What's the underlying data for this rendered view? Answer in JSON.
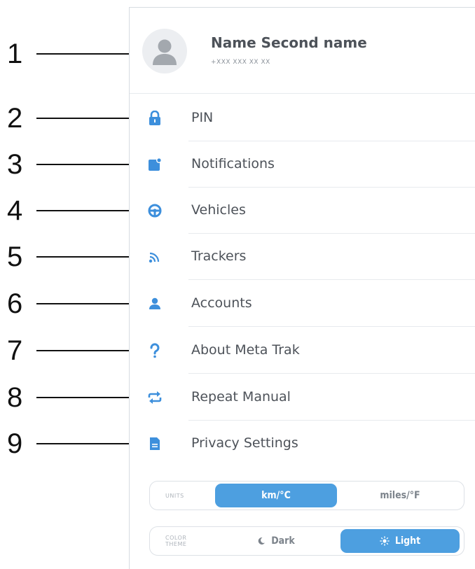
{
  "callouts": [
    "1",
    "2",
    "3",
    "4",
    "5",
    "6",
    "7",
    "8",
    "9"
  ],
  "profile": {
    "name": "Name Second name",
    "phone": "+XXX XXX XX XX"
  },
  "menu": [
    {
      "label": "PIN",
      "icon": "lock-icon"
    },
    {
      "label": "Notifications",
      "icon": "notification-icon"
    },
    {
      "label": "Vehicles",
      "icon": "steering-wheel-icon"
    },
    {
      "label": "Trackers",
      "icon": "signal-icon"
    },
    {
      "label": "Accounts",
      "icon": "user-icon"
    },
    {
      "label": "About Meta Trak",
      "icon": "question-icon"
    },
    {
      "label": "Repeat Manual",
      "icon": "repeat-icon"
    },
    {
      "label": "Privacy Settings",
      "icon": "document-icon"
    }
  ],
  "units": {
    "caption": "UNITS",
    "options": [
      "km/°C",
      "miles/°F"
    ],
    "selected": "km/°C"
  },
  "theme": {
    "caption_line1": "COLOR",
    "caption_line2": "THEME",
    "options": [
      "Dark",
      "Light"
    ],
    "selected": "Light"
  },
  "colors": {
    "accent": "#4d9fe0",
    "icon": "#3d8fdc",
    "text": "#4d5259"
  }
}
